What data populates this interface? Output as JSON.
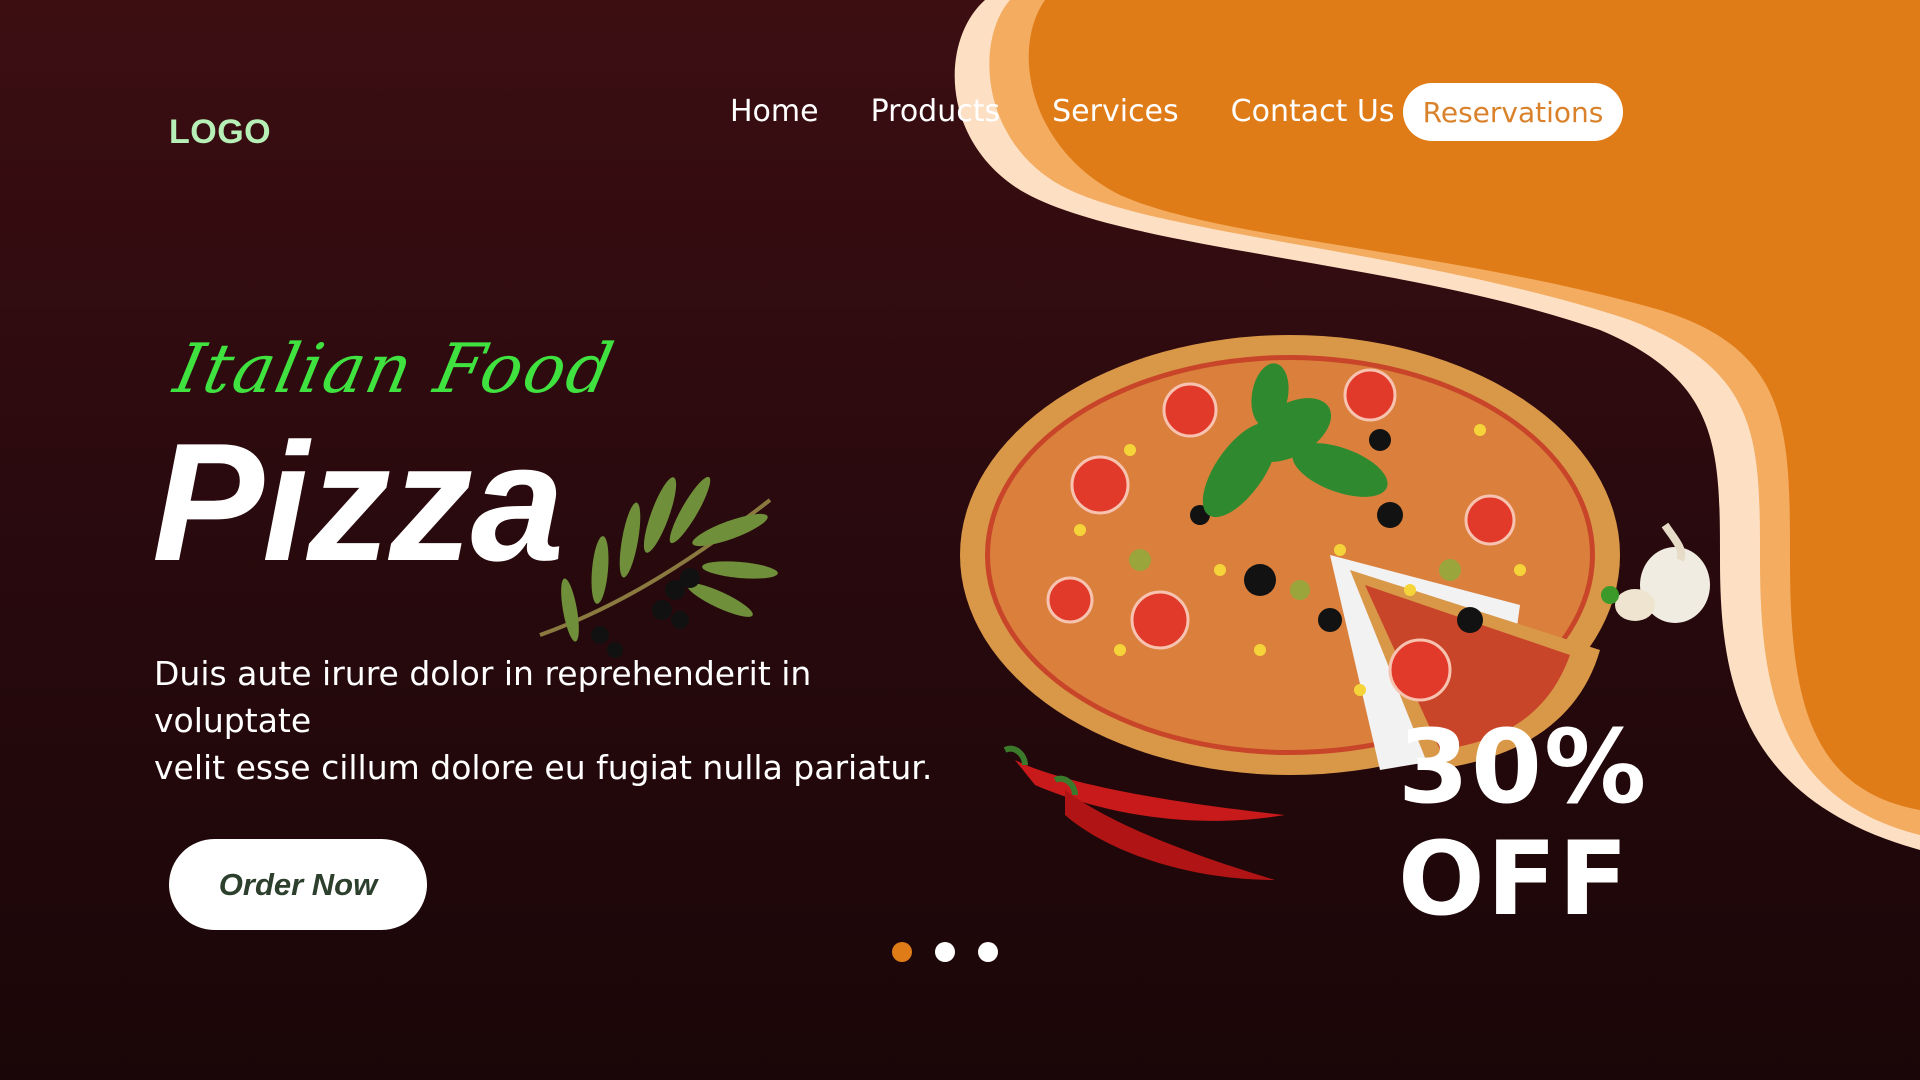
{
  "header": {
    "logo": "LOGO",
    "nav": [
      "Home",
      "Products",
      "Services",
      "Contact Us"
    ],
    "reservations_label": "Reservations"
  },
  "hero": {
    "subtitle": "Italian Food",
    "title": "Pizza",
    "description_line1": "Duis aute irure dolor in reprehenderit in voluptate",
    "description_line2": "velit esse cillum dolore eu fugiat nulla pariatur.",
    "order_label": "Order Now"
  },
  "promo": {
    "percent": "30%",
    "off": "OFF"
  },
  "carousel": {
    "active_index": 0,
    "count": 3
  },
  "colors": {
    "accent": "#e07c18",
    "background": "#2a0a0e",
    "logo": "#b7f0b6",
    "subtitle": "#3fe23f"
  },
  "icons": {
    "pizza": "pizza-image",
    "olive": "olive-branch-image",
    "chili": "chili-pepper-image",
    "garlic": "garlic-image"
  }
}
